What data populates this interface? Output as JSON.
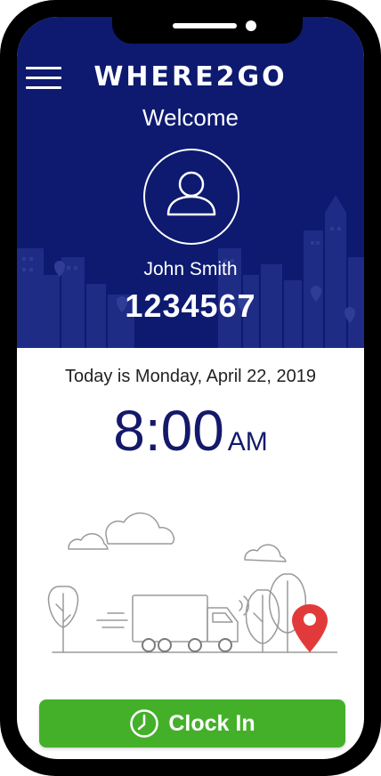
{
  "app": {
    "logo_text": "WHERE2GO",
    "welcome_label": "Welcome"
  },
  "user": {
    "name": "John Smith",
    "id": "1234567"
  },
  "status": {
    "date_text": "Today is Monday, April 22, 2019",
    "time": "8:00",
    "ampm": "AM"
  },
  "actions": {
    "clock_in_label": "Clock In"
  },
  "icons": {
    "menu": "hamburger-menu-icon",
    "avatar": "user-icon",
    "clock": "clock-icon",
    "map_pin": "map-pin-icon",
    "truck": "truck-icon"
  },
  "colors": {
    "header_bg": "#0d1a70",
    "time_text": "#14196a",
    "clock_in_button": "#44b02a",
    "map_pin": "#e23a3a"
  }
}
